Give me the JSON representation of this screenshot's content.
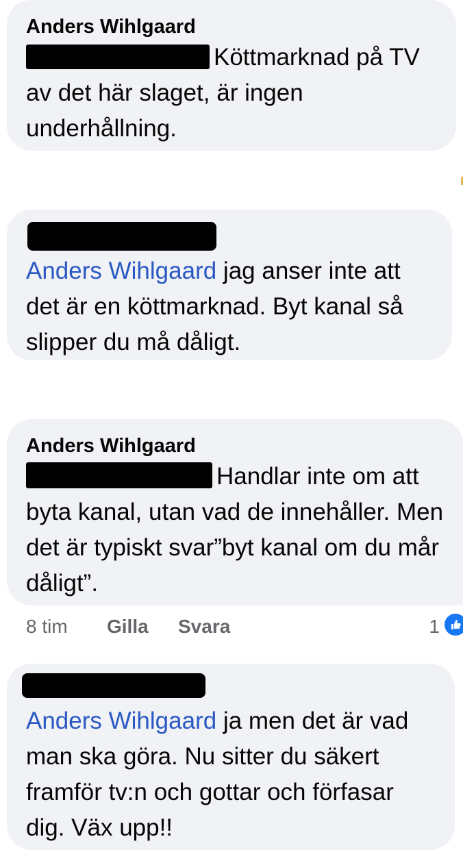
{
  "comments": [
    {
      "author": "Anders Wihlgaard",
      "text": "Köttmarknad på TV av det här slaget, är ingen underhållning."
    },
    {
      "mention": "Anders Wihlgaard",
      "text": " jag anser inte att det är en köttmarknad. Byt kanal så slipper du må dåligt."
    },
    {
      "author": "Anders Wihlgaard",
      "text": "Handlar inte om att byta kanal, utan vad de innehåller. Men det är typiskt svar”byt kanal om du mår dåligt”.",
      "actions": {
        "time": "8 tim",
        "like": "Gilla",
        "reply": "Svara",
        "reaction_count": "1"
      }
    },
    {
      "mention": "Anders Wihlgaard",
      "text": " ja men det är vad man ska göra. Nu sitter du säkert framför tv:n och gottar och förfasar dig. Väx upp!!"
    }
  ],
  "icons": {
    "reaction": "like-reaction-icon"
  },
  "colors": {
    "bubble": "#f0f2f5",
    "mention": "#2b59c3",
    "meta": "#65676b",
    "reaction": "#1877f2"
  }
}
